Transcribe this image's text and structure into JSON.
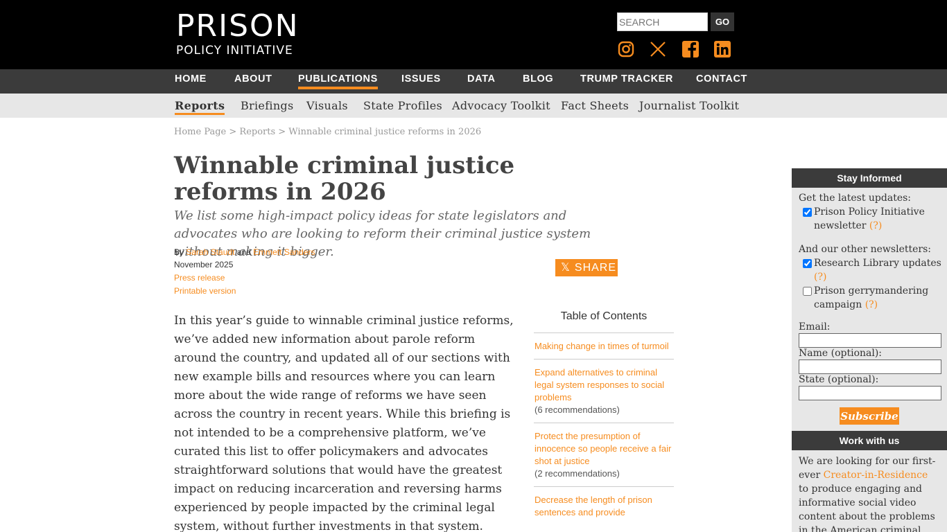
{
  "header": {
    "logo_line1": "PRISON",
    "logo_line2": "POLICY INITIATIVE",
    "search_placeholder": "SEARCH",
    "go_label": "GO",
    "social_icons": [
      "instagram-icon",
      "x-icon",
      "facebook-icon",
      "linkedin-icon"
    ],
    "accent_color": "#f68c1f"
  },
  "mainnav": [
    "HOME",
    "ABOUT",
    "PUBLICATIONS",
    "ISSUES",
    "DATA",
    "BLOG",
    "TRUMP TRACKER",
    "CONTACT"
  ],
  "subnav": [
    "Reports",
    "Briefings",
    "Visuals",
    "State Profiles",
    "Advocacy Toolkit",
    "Fact Sheets",
    "Journalist Toolkit"
  ],
  "breadcrumb": "Home Page > Reports > Winnable criminal justice reforms in 2026",
  "article": {
    "title": "Winnable criminal justice reforms in 2026",
    "subtitle": "We list some high-impact policy ideas for state legislators and advocates who are looking to reform their criminal justice system without making it bigger.",
    "by": "By",
    "author1": "Sarah Staudt",
    "and": "and",
    "author2": "Emmett Sanders",
    "date": "November 2025",
    "press_release": "Press release",
    "printable": "Printable version",
    "share_label": "SHARE",
    "body": "In this year’s guide to winnable criminal justice reforms, we’ve added new information about parole reform around the country, and updated all of our sections with new example bills and resources where you can learn more about the wide range of reforms we have seen across the country in recent years. While this briefing is not intended to be a comprehensive platform, we’ve curated this list to offer policymakers and advocates straightforward solutions that would have the greatest impact on reducing incarceration and reversing harms experienced by people impacted by the criminal legal system, without further investments in that system."
  },
  "toc": {
    "title": "Table of Contents",
    "entries": [
      {
        "label": "Making change in times of turmoil",
        "count": ""
      },
      {
        "label": "Expand alternatives to criminal legal system responses to social problems",
        "count": "(6 recommendations)"
      },
      {
        "label": "Protect the presumption of innocence so people receive a fair shot at justice",
        "count": "(2 recommendations)"
      },
      {
        "label": "Decrease the length of prison sentences and provide",
        "count": ""
      }
    ]
  },
  "sidebar": {
    "stay_informed": "Stay Informed",
    "latest_updates": "Get the latest updates:",
    "newsletter_label": "Prison Policy Initiative newsletter",
    "help": "(?)",
    "other_newsletters": "And our other newsletters:",
    "research_label": "Research Library updates",
    "gerrymandering_label": "Prison gerrymandering campaign",
    "email_label": "Email:",
    "name_label": "Name (optional):",
    "state_label": "State (optional):",
    "subscribe_label": "Subscribe",
    "work_with_us": "Work with us",
    "work_text_1": "We are looking for our first-ever",
    "work_link": "Creator-in-Residence",
    "work_text_2": "to produce engaging and informative social video content about the problems in the American criminal legal system."
  }
}
